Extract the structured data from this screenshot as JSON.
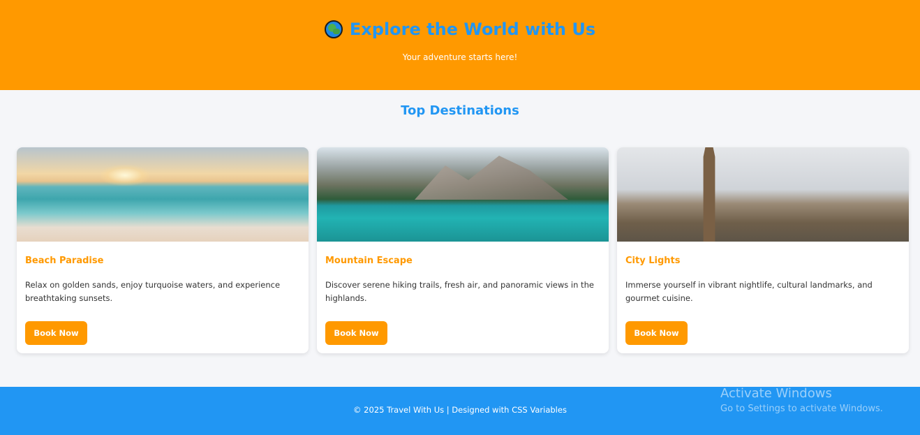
{
  "header": {
    "title": "Explore the World with Us",
    "subtitle": "Your adventure starts here!",
    "icon": "globe-icon",
    "background_color": "#ff9900",
    "title_color": "#2196f3"
  },
  "section": {
    "title": "Top Destinations"
  },
  "cards": [
    {
      "title": "Beach Paradise",
      "description": "Relax on golden sands, enjoy turquoise waters, and experience breathtaking sunsets.",
      "button_label": "Book Now",
      "image": "beach-sunset-image"
    },
    {
      "title": "Mountain Escape",
      "description": "Discover serene hiking trails, fresh air, and panoramic views in the highlands.",
      "button_label": "Book Now",
      "image": "mountain-lake-image"
    },
    {
      "title": "City Lights",
      "description": "Immerse yourself in vibrant nightlife, cultural landmarks, and gourmet cuisine.",
      "button_label": "Book Now",
      "image": "london-big-ben-image"
    }
  ],
  "footer": {
    "text": "© 2025 Travel With Us | Designed with CSS Variables",
    "background_color": "#2196f3"
  },
  "watermark": {
    "line1": "Activate Windows",
    "line2": "Go to Settings to activate Windows."
  },
  "colors": {
    "accent": "#ff9900",
    "primary": "#2196f3",
    "page_background": "#f5f6f9"
  }
}
